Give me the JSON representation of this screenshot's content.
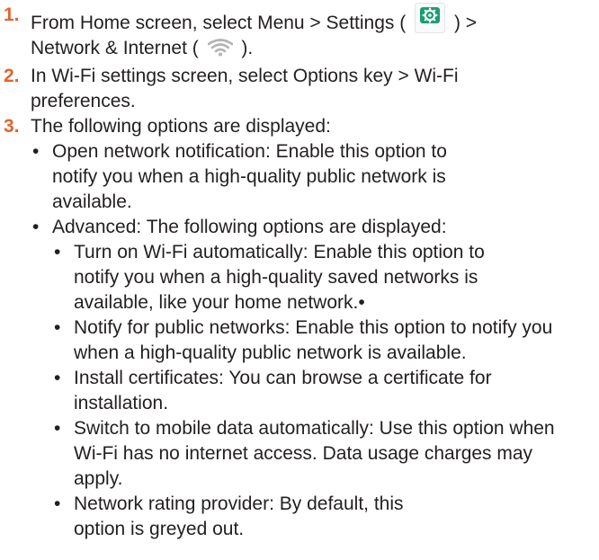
{
  "accent_color": "#e2652b",
  "icon_color": "#1b9e6f",
  "steps": [
    {
      "number": "1.",
      "text_a": "From Home screen, select Menu > Settings (",
      "settings_icon": "settings-gear-icon",
      "text_b": ") >",
      "text_c": "Network & Internet (",
      "wifi_icon": "wifi-icon",
      "text_d": ")."
    },
    {
      "number": "2.",
      "text": "In Wi-Fi settings screen, select Options key > Wi-Fi preferences."
    },
    {
      "number": "3.",
      "text": "The following options are displayed:",
      "bullet": "•",
      "items": [
        {
          "text": "Open network notification: Enable this option to notify you when a high-quality public network is available."
        },
        {
          "text": "Advanced: The following options are displayed:",
          "subitems": [
            "Turn on Wi-Fi automatically: Enable this option to notify you when a high-quality saved networks is available, like your home network.•",
            "Notify for public networks: Enable this option to notify you when a high-quality public network is available.",
            "Install certificates: You can browse a certificate for installation.",
            "Switch to mobile data automatically: Use this option when Wi-Fi has no internet access. Data usage charges may apply.",
            "Network rating provider: By default, this option is greyed out."
          ]
        }
      ]
    }
  ]
}
